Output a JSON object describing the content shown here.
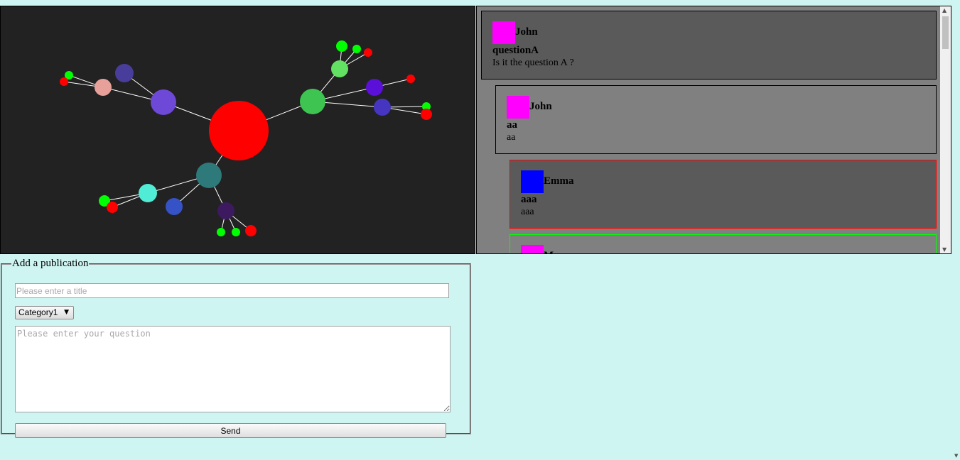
{
  "graph": {
    "background": "#222222",
    "nodes": [
      {
        "id": "root",
        "color": "#ff0000"
      },
      {
        "id": "purple-hub",
        "color": "#6e48d6"
      },
      {
        "id": "indigo-1",
        "color": "#483d9b"
      },
      {
        "id": "pink",
        "color": "#e8a09a"
      },
      {
        "id": "green-hub",
        "color": "#3ec450"
      },
      {
        "id": "light-green",
        "color": "#63e163"
      },
      {
        "id": "violet",
        "color": "#5a10d8"
      },
      {
        "id": "indigo-2",
        "color": "#4535c0"
      },
      {
        "id": "teal-hub",
        "color": "#2e7a7a"
      },
      {
        "id": "aqua",
        "color": "#50ecd6"
      },
      {
        "id": "blue",
        "color": "#3552c6"
      },
      {
        "id": "dark-purple",
        "color": "#3d1a60"
      }
    ],
    "leaf_colors": {
      "agree": "#00ff00",
      "disagree": "#ff0000"
    },
    "edge_color": "#ffffff"
  },
  "thread": {
    "posts": [
      {
        "author": "John",
        "avatar_color": "#ff00ff",
        "title": "questionA",
        "body": "Is it the question A ?",
        "background": "#5a5a5a",
        "border": "#000000"
      },
      {
        "author": "John",
        "avatar_color": "#ff00ff",
        "title": "aa",
        "body": "aa",
        "background": "#808080",
        "border": "#000000"
      },
      {
        "author": "Emma",
        "avatar_color": "#0000ff",
        "title": "aaa",
        "body": "aaa",
        "background": "#5a5a5a",
        "border": "#ff0000"
      },
      {
        "author": "M",
        "avatar_color": "#ff00ff",
        "title": "",
        "body": "",
        "background": "#808080",
        "border": "#00ff00"
      }
    ]
  },
  "form": {
    "legend": "Add a publication",
    "title_placeholder": "Please enter a title",
    "category_selected": "Category1",
    "question_placeholder": "Please enter your question",
    "send_label": "Send"
  }
}
